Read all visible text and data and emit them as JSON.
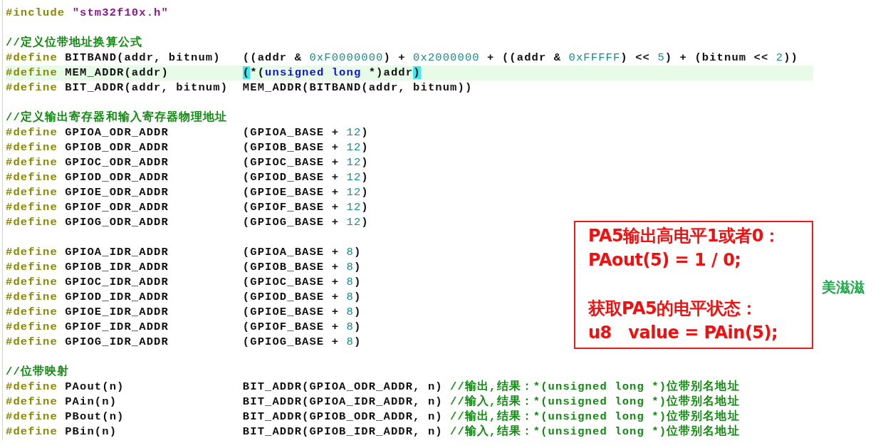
{
  "editor": {
    "blocks": [
      {
        "lines": [
          {
            "highlighted": false,
            "tokens": [
              {
                "kind": "pp",
                "text": "#include "
              },
              {
                "kind": "str",
                "text": "\"stm32f10x.h\""
              }
            ]
          }
        ]
      },
      {
        "lines": [
          {
            "highlighted": false,
            "tokens": [
              {
                "kind": "cmt",
                "text": "//定义位带地址换算公式"
              }
            ]
          },
          {
            "highlighted": false,
            "tokens": [
              {
                "kind": "pp",
                "text": "#define "
              },
              {
                "kind": "id",
                "text": "BITBAND(addr, bitnum)   ((addr & "
              },
              {
                "kind": "num",
                "text": "0xF0000000"
              },
              {
                "kind": "id",
                "text": ") + "
              },
              {
                "kind": "num",
                "text": "0x2000000"
              },
              {
                "kind": "id",
                "text": " + ((addr & "
              },
              {
                "kind": "num",
                "text": "0xFFFFF"
              },
              {
                "kind": "id",
                "text": ") << "
              },
              {
                "kind": "num",
                "text": "5"
              },
              {
                "kind": "id",
                "text": ") + (bitnum << "
              },
              {
                "kind": "num",
                "text": "2"
              },
              {
                "kind": "id",
                "text": "))"
              }
            ]
          },
          {
            "highlighted": true,
            "tokens": [
              {
                "kind": "pp",
                "text": "#define "
              },
              {
                "kind": "id",
                "text": "MEM_ADDR(addr)          "
              },
              {
                "kind": "brace",
                "text": "("
              },
              {
                "kind": "id",
                "text": "*("
              },
              {
                "kind": "kw",
                "text": "unsigned long"
              },
              {
                "kind": "id",
                "text": " *)addr"
              },
              {
                "kind": "brace",
                "text": ")"
              }
            ]
          },
          {
            "highlighted": false,
            "tokens": [
              {
                "kind": "pp",
                "text": "#define "
              },
              {
                "kind": "id",
                "text": "BIT_ADDR(addr, bitnum)  MEM_ADDR(BITBAND(addr, bitnum))"
              }
            ]
          }
        ]
      },
      {
        "lines": [
          {
            "highlighted": false,
            "tokens": [
              {
                "kind": "cmt",
                "text": "//定义输出寄存器和输入寄存器物理地址"
              }
            ]
          },
          {
            "highlighted": false,
            "tokens": [
              {
                "kind": "pp",
                "text": "#define "
              },
              {
                "kind": "id",
                "text": "GPIOA_ODR_ADDR          (GPIOA_BASE + "
              },
              {
                "kind": "num",
                "text": "12"
              },
              {
                "kind": "id",
                "text": ")"
              }
            ]
          },
          {
            "highlighted": false,
            "tokens": [
              {
                "kind": "pp",
                "text": "#define "
              },
              {
                "kind": "id",
                "text": "GPIOB_ODR_ADDR          (GPIOB_BASE + "
              },
              {
                "kind": "num",
                "text": "12"
              },
              {
                "kind": "id",
                "text": ")"
              }
            ]
          },
          {
            "highlighted": false,
            "tokens": [
              {
                "kind": "pp",
                "text": "#define "
              },
              {
                "kind": "id",
                "text": "GPIOC_ODR_ADDR          (GPIOC_BASE + "
              },
              {
                "kind": "num",
                "text": "12"
              },
              {
                "kind": "id",
                "text": ")"
              }
            ]
          },
          {
            "highlighted": false,
            "tokens": [
              {
                "kind": "pp",
                "text": "#define "
              },
              {
                "kind": "id",
                "text": "GPIOD_ODR_ADDR          (GPIOD_BASE + "
              },
              {
                "kind": "num",
                "text": "12"
              },
              {
                "kind": "id",
                "text": ")"
              }
            ]
          },
          {
            "highlighted": false,
            "tokens": [
              {
                "kind": "pp",
                "text": "#define "
              },
              {
                "kind": "id",
                "text": "GPIOE_ODR_ADDR          (GPIOE_BASE + "
              },
              {
                "kind": "num",
                "text": "12"
              },
              {
                "kind": "id",
                "text": ")"
              }
            ]
          },
          {
            "highlighted": false,
            "tokens": [
              {
                "kind": "pp",
                "text": "#define "
              },
              {
                "kind": "id",
                "text": "GPIOF_ODR_ADDR          (GPIOF_BASE + "
              },
              {
                "kind": "num",
                "text": "12"
              },
              {
                "kind": "id",
                "text": ")"
              }
            ]
          },
          {
            "highlighted": false,
            "tokens": [
              {
                "kind": "pp",
                "text": "#define "
              },
              {
                "kind": "id",
                "text": "GPIOG_ODR_ADDR          (GPIOG_BASE + "
              },
              {
                "kind": "num",
                "text": "12"
              },
              {
                "kind": "id",
                "text": ")"
              }
            ]
          }
        ]
      },
      {
        "lines": [
          {
            "highlighted": false,
            "tokens": [
              {
                "kind": "pp",
                "text": "#define "
              },
              {
                "kind": "id",
                "text": "GPIOA_IDR_ADDR          (GPIOA_BASE + "
              },
              {
                "kind": "num",
                "text": "8"
              },
              {
                "kind": "id",
                "text": ")"
              }
            ]
          },
          {
            "highlighted": false,
            "tokens": [
              {
                "kind": "pp",
                "text": "#define "
              },
              {
                "kind": "id",
                "text": "GPIOB_IDR_ADDR          (GPIOB_BASE + "
              },
              {
                "kind": "num",
                "text": "8"
              },
              {
                "kind": "id",
                "text": ")"
              }
            ]
          },
          {
            "highlighted": false,
            "tokens": [
              {
                "kind": "pp",
                "text": "#define "
              },
              {
                "kind": "id",
                "text": "GPIOC_IDR_ADDR          (GPIOC_BASE + "
              },
              {
                "kind": "num",
                "text": "8"
              },
              {
                "kind": "id",
                "text": ")"
              }
            ]
          },
          {
            "highlighted": false,
            "tokens": [
              {
                "kind": "pp",
                "text": "#define "
              },
              {
                "kind": "id",
                "text": "GPIOD_IDR_ADDR          (GPIOD_BASE + "
              },
              {
                "kind": "num",
                "text": "8"
              },
              {
                "kind": "id",
                "text": ")"
              }
            ]
          },
          {
            "highlighted": false,
            "tokens": [
              {
                "kind": "pp",
                "text": "#define "
              },
              {
                "kind": "id",
                "text": "GPIOE_IDR_ADDR          (GPIOE_BASE + "
              },
              {
                "kind": "num",
                "text": "8"
              },
              {
                "kind": "id",
                "text": ")"
              }
            ]
          },
          {
            "highlighted": false,
            "tokens": [
              {
                "kind": "pp",
                "text": "#define "
              },
              {
                "kind": "id",
                "text": "GPIOF_IDR_ADDR          (GPIOF_BASE + "
              },
              {
                "kind": "num",
                "text": "8"
              },
              {
                "kind": "id",
                "text": ")"
              }
            ]
          },
          {
            "highlighted": false,
            "tokens": [
              {
                "kind": "pp",
                "text": "#define "
              },
              {
                "kind": "id",
                "text": "GPIOG_IDR_ADDR          (GPIOG_BASE + "
              },
              {
                "kind": "num",
                "text": "8"
              },
              {
                "kind": "id",
                "text": ")"
              }
            ]
          }
        ]
      },
      {
        "lines": [
          {
            "highlighted": false,
            "tokens": [
              {
                "kind": "cmt",
                "text": "//位带映射"
              }
            ]
          },
          {
            "highlighted": false,
            "tokens": [
              {
                "kind": "pp",
                "text": "#define "
              },
              {
                "kind": "id",
                "text": "PAout(n)                BIT_ADDR(GPIOA_ODR_ADDR, n) "
              },
              {
                "kind": "cmt",
                "text": "//输出,结果：*(unsigned long *)位带别名地址"
              }
            ]
          },
          {
            "highlighted": false,
            "tokens": [
              {
                "kind": "pp",
                "text": "#define "
              },
              {
                "kind": "id",
                "text": "PAin(n)                 BIT_ADDR(GPIOA_IDR_ADDR, n) "
              },
              {
                "kind": "cmt",
                "text": "//输入,结果：*(unsigned long *)位带别名地址"
              }
            ]
          },
          {
            "highlighted": false,
            "tokens": [
              {
                "kind": "pp",
                "text": "#define "
              },
              {
                "kind": "id",
                "text": "PBout(n)                BIT_ADDR(GPIOB_ODR_ADDR, n) "
              },
              {
                "kind": "cmt",
                "text": "//输出,结果：*(unsigned long *)位带别名地址"
              }
            ]
          },
          {
            "highlighted": false,
            "tokens": [
              {
                "kind": "pp",
                "text": "#define "
              },
              {
                "kind": "id",
                "text": "PBin(n)                 BIT_ADDR(GPIOB_IDR_ADDR, n) "
              },
              {
                "kind": "cmt",
                "text": "//输入,结果：*(unsigned long *)位带别名地址"
              }
            ]
          }
        ]
      }
    ]
  },
  "note": {
    "groups": [
      [
        "PA5输出高电平1或者0：",
        "PAout(5) = 1 / 0;"
      ],
      [
        "获取PA5的电平状态：",
        "u8   value = PAin(5);"
      ]
    ]
  },
  "side_label": "美滋滋"
}
